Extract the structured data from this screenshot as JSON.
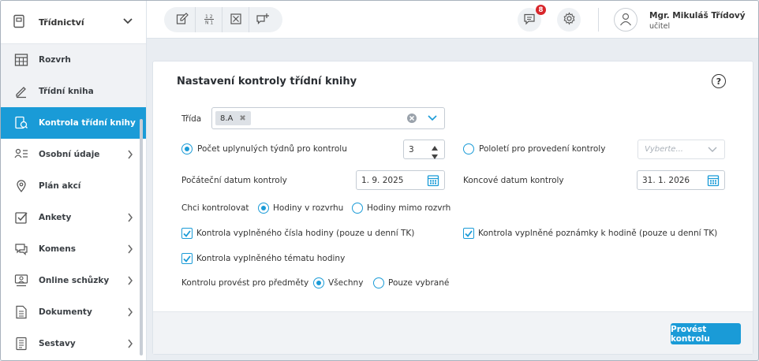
{
  "sidebar": {
    "header": "Třídnictví",
    "items": [
      {
        "label": "Rozvrh",
        "icon": "timetable-icon"
      },
      {
        "label": "Třídní kniha",
        "icon": "pen-book-icon"
      },
      {
        "label": "Kontrola třídní knihy",
        "icon": "book-check-icon",
        "active": true
      },
      {
        "label": "Osobní údaje",
        "icon": "person-list-icon",
        "arrow": true
      },
      {
        "label": "Plán akcí",
        "icon": "map-pin-icon"
      },
      {
        "label": "Ankety",
        "icon": "checkbox-icon",
        "arrow": true
      },
      {
        "label": "Komens",
        "icon": "chat-icon",
        "arrow": true
      },
      {
        "label": "Online schůzky",
        "icon": "video-meeting-icon",
        "arrow": true
      },
      {
        "label": "Dokumenty",
        "icon": "document-icon",
        "arrow": true
      },
      {
        "label": "Sestavy",
        "icon": "report-icon",
        "arrow": true
      }
    ]
  },
  "topbar": {
    "notification_count": "8",
    "user_name": "Mgr. Mikuláš Třídový",
    "user_role": "učitel"
  },
  "form": {
    "title": "Nastavení kontroly třídní knihy",
    "help": "?",
    "class_label": "Třída",
    "class_chip": "8.A",
    "weeks_radio_label": "Počet uplynulých týdnů pro kontrolu",
    "weeks_value": "3",
    "semester_radio_label": "Pololetí pro provedení kontroly",
    "semester_placeholder": "Vyberte...",
    "start_date_label": "Počáteční datum kontroly",
    "start_date_value": "1. 9. 2025",
    "end_date_label": "Koncové datum kontroly",
    "end_date_value": "31. 1. 2026",
    "check_label": "Chci kontrolovat",
    "hours_schedule": "Hodiny v rozvrhu",
    "hours_outside": "Hodiny mimo rozvrh",
    "check_number": "Kontrola vyplněného čísla hodiny (pouze u denní TK)",
    "check_note": "Kontrola vyplněné poznámky k hodině (pouze u denní TK)",
    "check_topic": "Kontrola vyplněného tématu hodiny",
    "subjects_label": "Kontrolu provést pro předměty",
    "subjects_all": "Všechny",
    "subjects_selected": "Pouze vybrané",
    "submit": "Provést kontrolu"
  },
  "colors": {
    "accent": "#1a9bd7",
    "badge": "#d8262b"
  }
}
